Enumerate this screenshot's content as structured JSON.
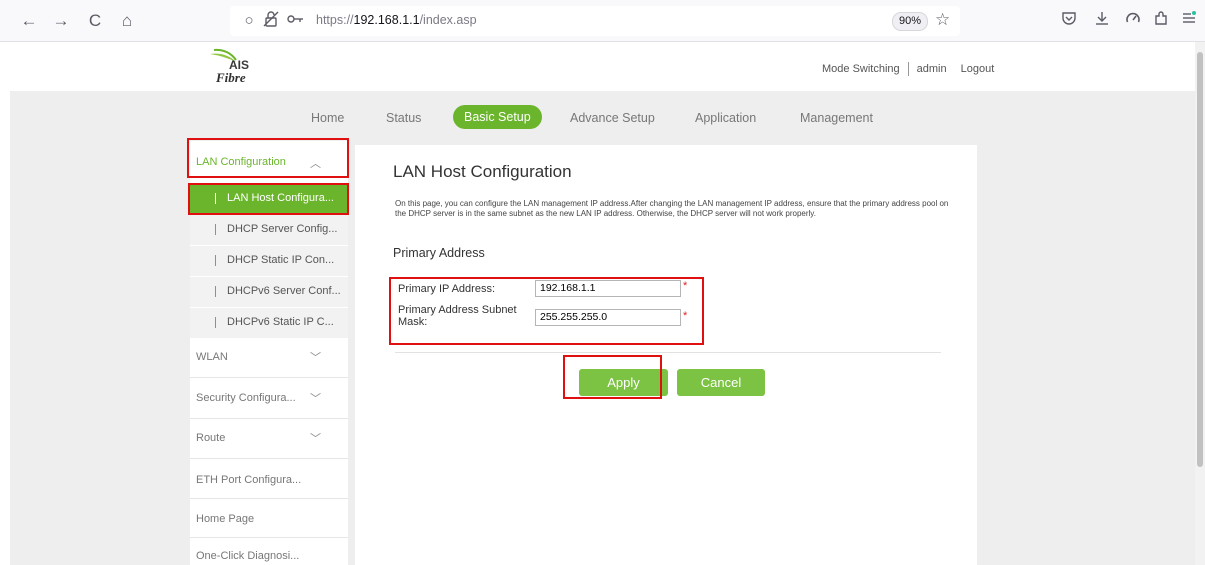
{
  "browser": {
    "back_icon": "←",
    "forward_icon": "→",
    "reload_icon": "C",
    "home_icon": "⌂",
    "url_prefix": "https://",
    "url_host": "192.168.1.1",
    "url_path": "/index.asp",
    "zoom": "90%"
  },
  "header": {
    "logo_ais": "AIS",
    "logo_fibre": "Fibre",
    "mode_switching": "Mode Switching",
    "user": "admin",
    "logout": "Logout"
  },
  "topnav": {
    "tabs": [
      "Home",
      "Status",
      "Basic Setup",
      "Advance Setup",
      "Application",
      "Management"
    ],
    "active": "Basic Setup"
  },
  "sidebar": {
    "group": "LAN Configuration",
    "sub_items": [
      "LAN Host Configura...",
      "DHCP Server Config...",
      "DHCP Static IP Con...",
      "DHCPv6 Server Conf...",
      "DHCPv6 Static IP C..."
    ],
    "items": [
      "WLAN",
      "Security Configura...",
      "Route",
      "ETH Port Configura...",
      "Home Page",
      "One-Click Diagnosi..."
    ]
  },
  "panel": {
    "title": "LAN Host Configuration",
    "description": "On this page, you can configure the LAN management IP address.After changing the LAN management IP address, ensure that the primary address pool on the DHCP server is in the same subnet as the new LAN IP address. Otherwise, the DHCP server will not work properly.",
    "section": "Primary Address",
    "ip_label": "Primary IP Address:",
    "ip_value": "192.168.1.1",
    "mask_label": "Primary Address Subnet Mask:",
    "mask_value": "255.255.255.0",
    "required_mark": "*",
    "apply": "Apply",
    "cancel": "Cancel"
  },
  "colors": {
    "accent": "#6bb52c",
    "button": "#7cc243",
    "highlight": "#e01010"
  }
}
